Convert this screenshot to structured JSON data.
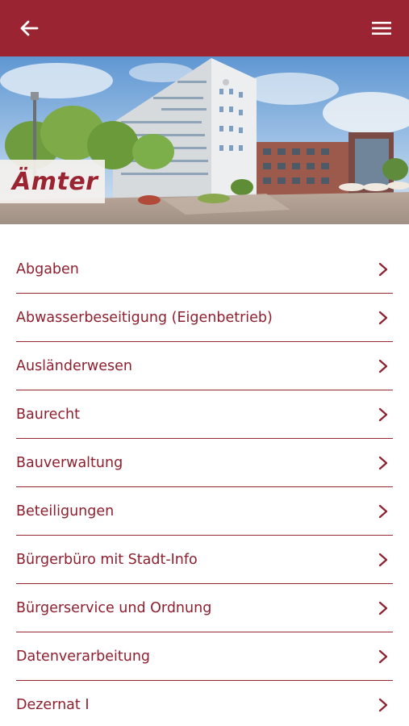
{
  "header": {
    "back_icon": "arrow-left-icon",
    "menu_icon": "hamburger-menu-icon",
    "bar_color": "#9b2433"
  },
  "hero": {
    "title": "Ämter",
    "image": "town-hall-photo"
  },
  "list": {
    "accent_color": "#9b2433",
    "chevron_icon": "chevron-right-icon",
    "items": [
      {
        "label": "Abgaben"
      },
      {
        "label": "Abwasserbeseitigung (Eigenbetrieb)"
      },
      {
        "label": "Ausländerwesen"
      },
      {
        "label": "Baurecht"
      },
      {
        "label": "Bauverwaltung"
      },
      {
        "label": "Beteiligungen"
      },
      {
        "label": "Bürgerbüro mit Stadt-Info"
      },
      {
        "label": "Bürgerservice und Ordnung"
      },
      {
        "label": "Datenverarbeitung"
      },
      {
        "label": "Dezernat I"
      }
    ]
  }
}
